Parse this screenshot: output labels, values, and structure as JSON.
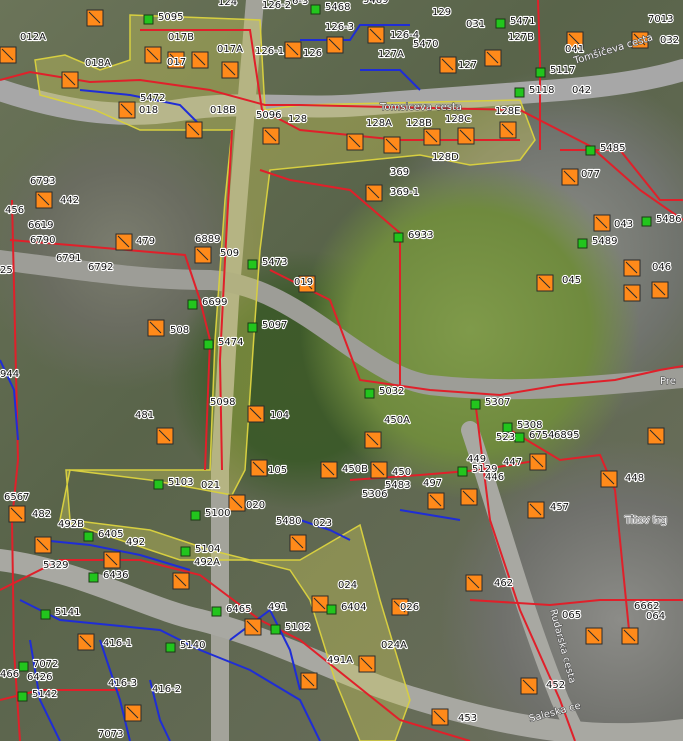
{
  "map": {
    "type": "cadastral / utility orthophoto map",
    "colors": {
      "red_network": "#e0202a",
      "blue_network": "#1f2dd6",
      "parcel_highlight": "#d7d35a",
      "marker": "#ff8a1a",
      "node": "#22c51d"
    },
    "street_labels": [
      "Tomšičeva cesta",
      "Tomsiceva cesta",
      "Rudarska cesta",
      "Titov trg",
      "Saleska ce",
      "Pre"
    ],
    "labels": [
      "129",
      "031",
      "5471",
      "127B",
      "041",
      "7013",
      "032",
      "5117",
      "5118",
      "042",
      "5095",
      "5468",
      "126-2",
      "5469",
      "6-3",
      "124",
      "126-3",
      "126-1",
      "126",
      "126-4",
      "5470",
      "127",
      "127A",
      "017B",
      "017A",
      "017",
      "018A",
      "012A",
      "5472",
      "018",
      "018B",
      "5096",
      "128",
      "128A",
      "128B",
      "128C",
      "128E",
      "128D",
      "5485",
      "077",
      "6793",
      "442",
      "369",
      "369-1",
      "456",
      "6619",
      "6790",
      "6791",
      "6792",
      "479",
      "6889",
      "509",
      "6933",
      "5489",
      "043",
      "5486",
      "046",
      "045",
      "5473",
      "019",
      "6699",
      "5097",
      "508",
      "5474",
      "944",
      "5032",
      "5307",
      "5308",
      "6754",
      "6895",
      "523",
      "7",
      "5098",
      "104",
      "450A",
      "449",
      "5129",
      "447",
      "446",
      "481",
      "105",
      "450B",
      "450",
      "5483",
      "497",
      "448",
      "5103",
      "021",
      "5100",
      "020",
      "5306",
      "457",
      "6567",
      "482",
      "492B",
      "6405",
      "492",
      "5104",
      "492A",
      "5480",
      "023",
      "Titov trg",
      "5329",
      "6436",
      "462",
      "024",
      "6465",
      "491",
      "5102",
      "6404",
      "026",
      "065",
      "6662",
      "064",
      "5141",
      "5140",
      "416-1",
      "024A",
      "7072",
      "491A",
      "6426",
      "5142",
      "416-3",
      "416-2",
      "452",
      "453",
      "7073",
      "466",
      "25"
    ]
  }
}
